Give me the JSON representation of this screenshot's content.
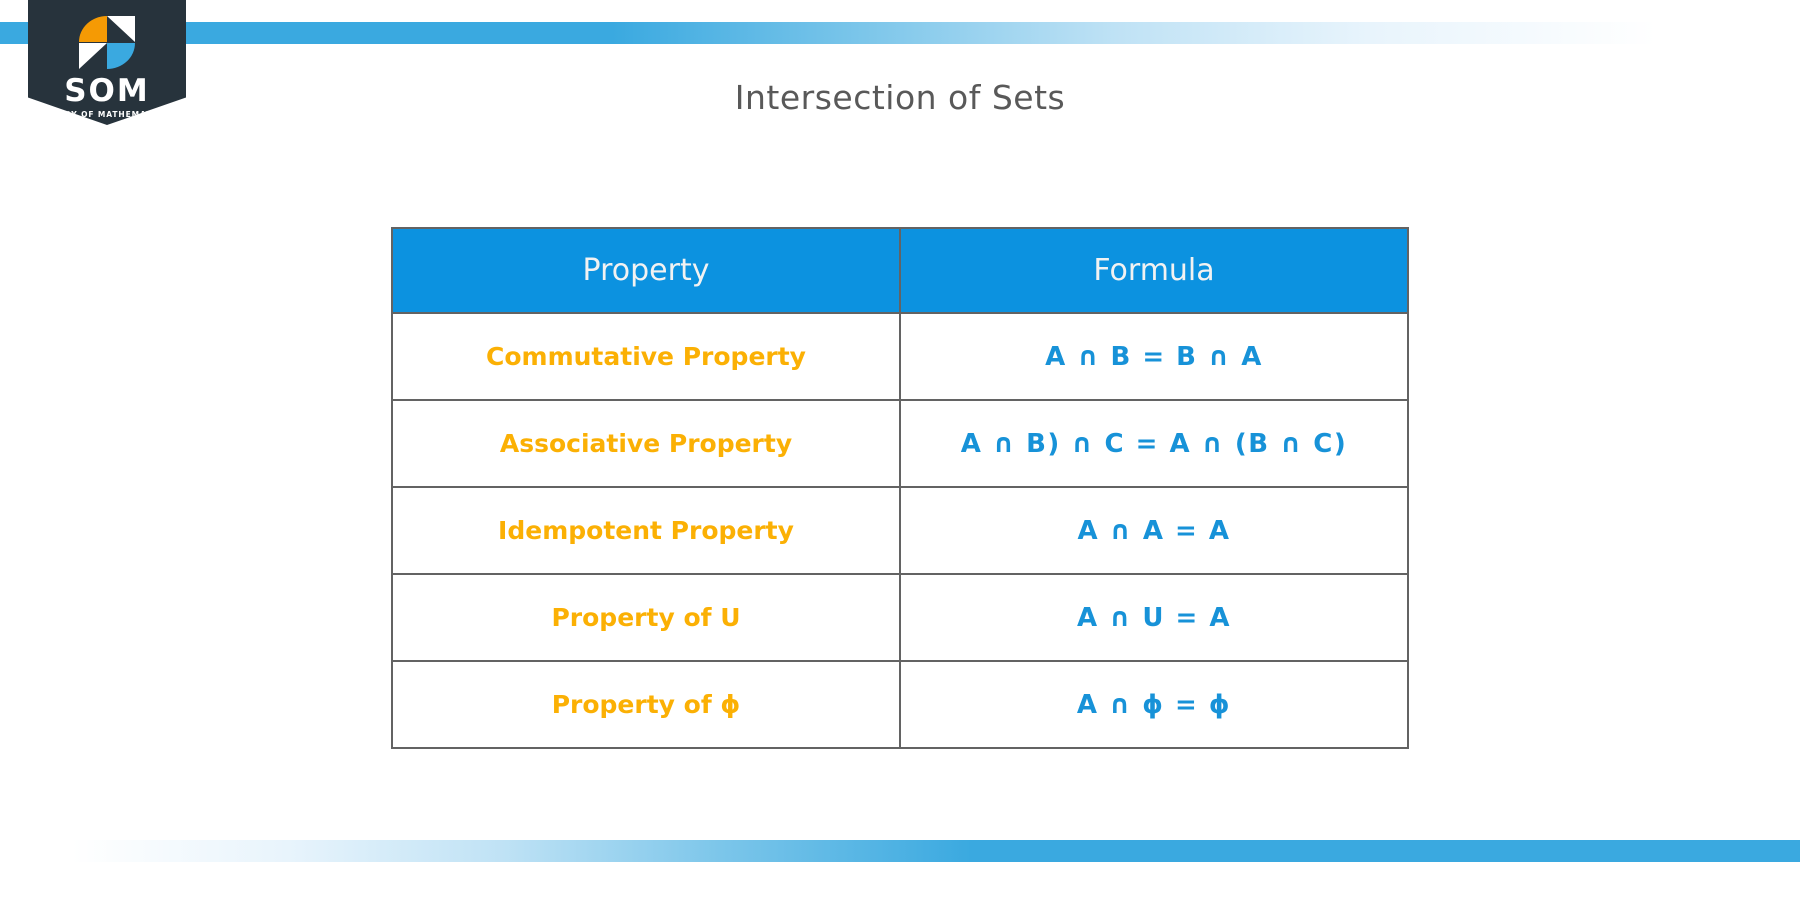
{
  "brand": {
    "wordmark": "SOM",
    "tagline": "STORY OF MATHEMATICS",
    "banner_color": "#27333c",
    "accent_orange": "#f59a04",
    "accent_blue": "#3aa9e0"
  },
  "page": {
    "title": "Intersection of Sets",
    "title_color": "#595959",
    "background": "#ffffff"
  },
  "decor": {
    "stripe_color": "#3aa9e0"
  },
  "table": {
    "header_background": "#0c92e0",
    "header_text_color": "#f2f2f2",
    "property_text_color": "#fbb004",
    "formula_text_color": "#1792d8",
    "border_color": "#636363",
    "columns": [
      "Property",
      "Formula"
    ],
    "rows": [
      {
        "property": "Commutative Property",
        "formula": "A ∩ B = B ∩ A"
      },
      {
        "property": "Associative Property",
        "formula": "A ∩ B) ∩ C = A ∩ (B ∩ C)"
      },
      {
        "property": "Idempotent Property",
        "formula": "A ∩ A = A"
      },
      {
        "property": "Property of U",
        "formula": "A ∩ U = A"
      },
      {
        "property": "Property of ϕ",
        "formula": "A ∩ ϕ = ϕ"
      }
    ]
  }
}
